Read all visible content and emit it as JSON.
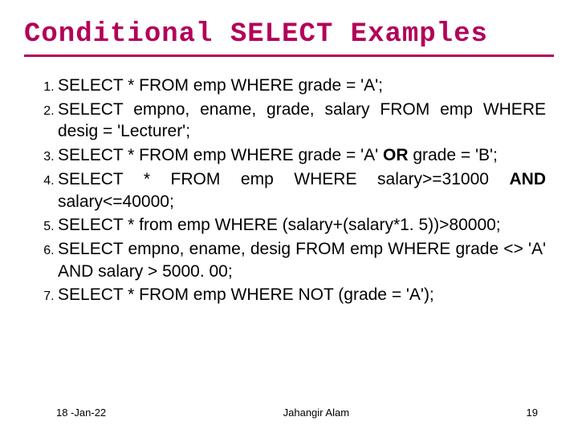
{
  "slide": {
    "title": "Conditional SELECT Examples",
    "items": {
      "i1": "SELECT * FROM emp WHERE grade = 'A';",
      "i2_a": "SELECT empno, ename, grade, salary FROM emp WHERE desig = 'Lecturer';",
      "i3_a": "SELECT * FROM emp WHERE grade = 'A' ",
      "i3_b": "OR",
      "i3_c": " grade = 'B';",
      "i4_a": "SELECT * FROM emp WHERE salary>=31000 ",
      "i4_b": "AND",
      "i4_c": " salary<=40000;",
      "i5": "SELECT * from emp WHERE (salary+(salary*1. 5))>80000;",
      "i6": "SELECT empno, ename, desig FROM emp WHERE grade <> 'A' AND salary > 5000. 00;",
      "i7": "SELECT * FROM emp WHERE NOT (grade = 'A');"
    },
    "footer": {
      "date": "18 -Jan-22",
      "author": "Jahangir Alam",
      "page": "19"
    }
  }
}
